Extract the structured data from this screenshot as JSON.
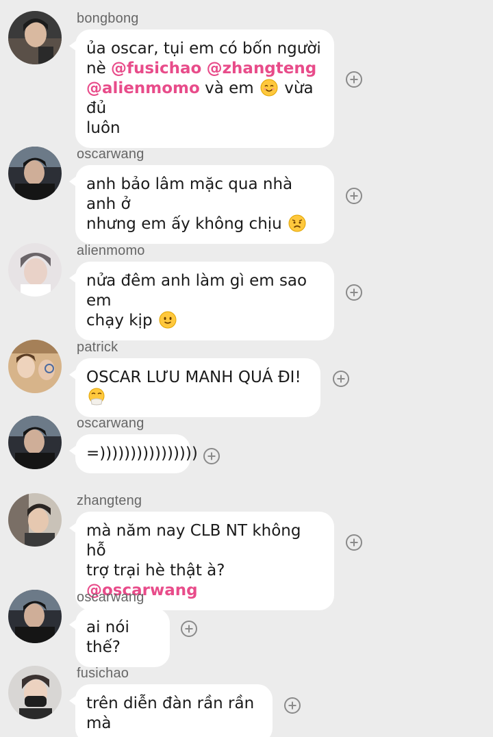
{
  "messages": [
    {
      "username": "bongbong",
      "parts": [
        {
          "t": "ủa oscar, tụi em có bốn người"
        },
        {
          "br": true
        },
        {
          "t": "nè "
        },
        {
          "m": "@fusichao"
        },
        {
          "t": " "
        },
        {
          "m": "@zhangteng"
        },
        {
          "br": true
        },
        {
          "m": "@alienmomo"
        },
        {
          "t": " và em "
        },
        {
          "e": "smiling-face-emoji"
        },
        {
          "t": " vừa đủ"
        },
        {
          "br": true
        },
        {
          "t": "luôn"
        }
      ]
    },
    {
      "username": "oscarwang",
      "parts": [
        {
          "t": "anh bảo lâm mặc qua nhà anh ở"
        },
        {
          "br": true
        },
        {
          "t": "nhưng em ấy không chịu "
        },
        {
          "e": "worried-face-emoji"
        }
      ]
    },
    {
      "username": "alienmomo",
      "parts": [
        {
          "t": "nửa đêm anh làm gì em sao em"
        },
        {
          "br": true
        },
        {
          "t": "chạy kịp "
        },
        {
          "e": "slightly-smiling-face-emoji"
        }
      ]
    },
    {
      "username": "patrick",
      "parts": [
        {
          "t": "OSCAR LƯU MANH QUÁ ĐI! "
        },
        {
          "e": "face-with-hand-over-mouth-emoji"
        }
      ]
    },
    {
      "username": "oscarwang",
      "parts": [
        {
          "t": "=))))))))))))))))"
        }
      ]
    },
    {
      "username": "zhangteng",
      "parts": [
        {
          "t": "mà năm nay CLB NT không hỗ"
        },
        {
          "br": true
        },
        {
          "t": "trợ trại hè thật à? "
        },
        {
          "m": "@oscarwang"
        }
      ]
    },
    {
      "username": "oscarwang",
      "parts": [
        {
          "t": "ai nói thế?"
        }
      ]
    },
    {
      "username": "fusichao",
      "parts": [
        {
          "t": "trên diễn đàn rần rần mà"
        }
      ]
    }
  ]
}
